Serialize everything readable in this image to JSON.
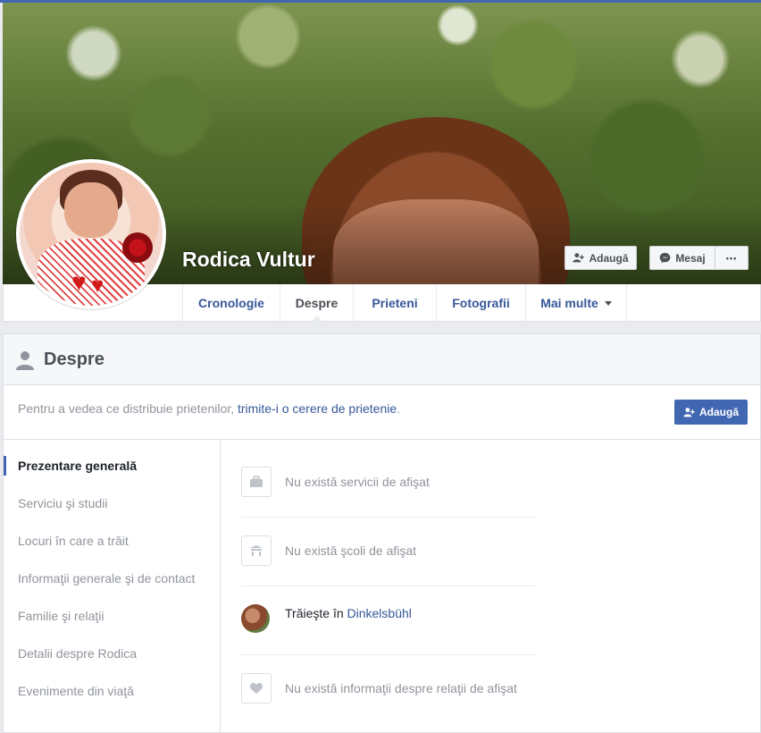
{
  "profile": {
    "name": "Rodica Vultur",
    "buttons": {
      "add_friend": "Adaugă",
      "message": "Mesaj",
      "more": "•••"
    }
  },
  "tabs": [
    {
      "label": "Cronologie"
    },
    {
      "label": "Despre"
    },
    {
      "label": "Prieteni"
    },
    {
      "label": "Fotografii"
    },
    {
      "label": "Mai multe"
    }
  ],
  "about": {
    "title": "Despre",
    "notice_prefix": "Pentru a vedea ce distribuie prietenilor, ",
    "notice_link": "trimite-i o cerere de prietenie",
    "notice_suffix": ".",
    "add_button": "Adaugă",
    "nav": [
      "Prezentare generală",
      "Serviciu şi studii",
      "Locuri în care a trăit",
      "Informaţii generale şi de contact",
      "Familie şi relaţii",
      "Detalii despre Rodica",
      "Evenimente din viaţă"
    ],
    "items": {
      "work": "Nu există servicii de afişat",
      "school": "Nu există şcoli de afişat",
      "lives_prefix": "Trăieşte în ",
      "lives_place": "Dinkelsbühl",
      "relationship": "Nu există informaţii despre relaţii de afişat"
    }
  },
  "colors": {
    "brand": "#4267b2",
    "link": "#365899",
    "muted": "#90949c"
  },
  "icons": [
    "person-add-icon",
    "messenger-icon",
    "more-icon",
    "person-icon",
    "briefcase-icon",
    "school-icon",
    "heart-icon"
  ]
}
